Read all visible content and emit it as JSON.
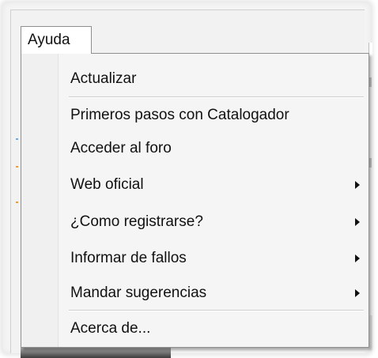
{
  "menubar": {
    "label": "Ayuda"
  },
  "menu": {
    "items": [
      {
        "label": "Actualizar",
        "submenu": false
      },
      {
        "label": "Primeros pasos con Catalogador",
        "submenu": false
      },
      {
        "label": "Acceder al foro",
        "submenu": false
      },
      {
        "label": "Web oficial",
        "submenu": true
      },
      {
        "label": "¿Como registrarse?",
        "submenu": true
      },
      {
        "label": "Informar de fallos",
        "submenu": true
      },
      {
        "label": "Mandar sugerencias",
        "submenu": true
      },
      {
        "label": "Acerca de...",
        "submenu": false
      }
    ]
  },
  "colors": {
    "menu_bg": "#f5f5f5",
    "border": "#8f8f8f",
    "text": "#111111"
  }
}
